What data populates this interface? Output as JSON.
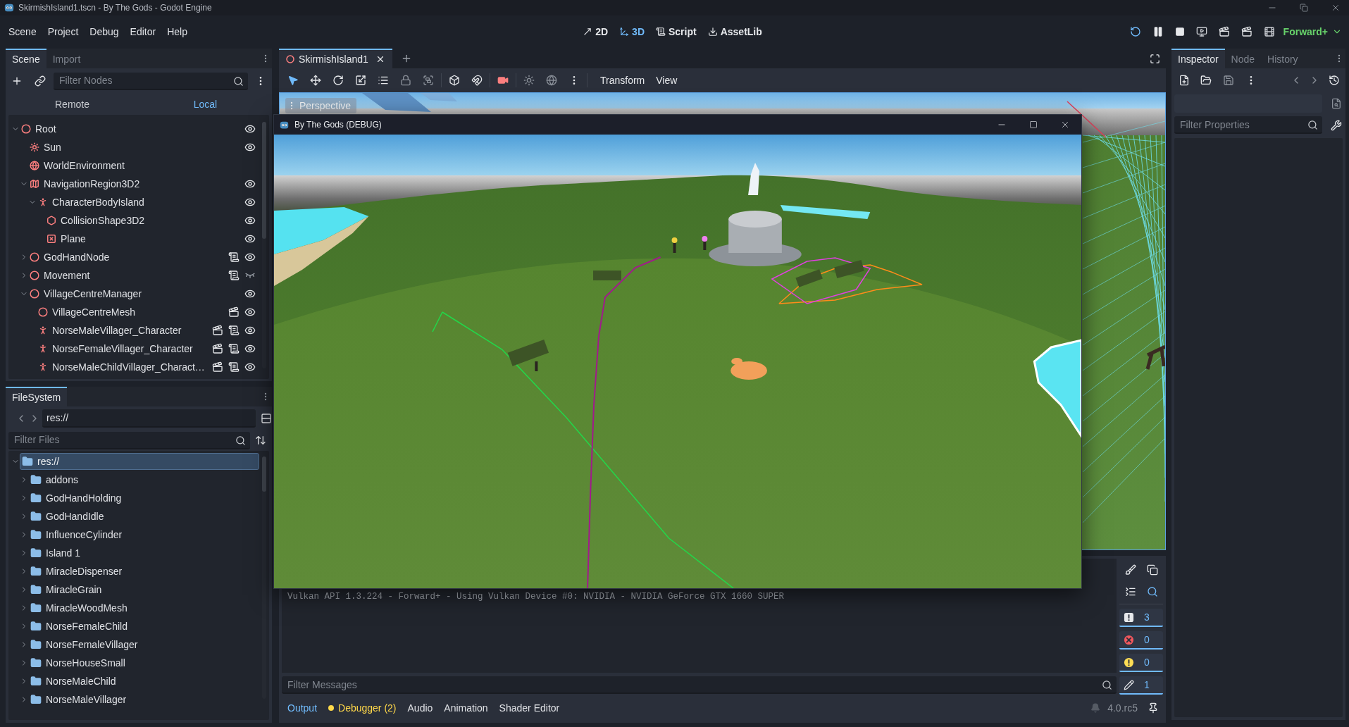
{
  "window": {
    "title": "SkirmishIsland1.tscn - By The Gods - Godot Engine"
  },
  "menu": [
    "Scene",
    "Project",
    "Debug",
    "Editor",
    "Help"
  ],
  "workspaces": [
    {
      "kind": "flat",
      "label": "2D",
      "selected": false
    },
    {
      "kind": "spatial",
      "label": "3D",
      "selected": true
    },
    {
      "kind": "script",
      "label": "Script",
      "selected": false
    },
    {
      "kind": "assetlib",
      "label": "AssetLib",
      "selected": false
    }
  ],
  "renderer": "Forward+",
  "scene_dock": {
    "tabs": [
      {
        "label": "Scene",
        "selected": true
      },
      {
        "label": "Import",
        "selected": false
      }
    ],
    "filter_placeholder": "Filter Nodes",
    "modes": [
      {
        "label": "Remote",
        "selected": false
      },
      {
        "label": "Local",
        "selected": true
      }
    ],
    "tree": [
      {
        "name": "Root",
        "kind": "node",
        "expanded": true,
        "visible": true,
        "children": [
          {
            "name": "Sun",
            "kind": "light",
            "visible": true
          },
          {
            "name": "WorldEnvironment",
            "kind": "environment"
          },
          {
            "name": "NavigationRegion3D2",
            "kind": "navigation",
            "expanded": true,
            "visible": true,
            "children": [
              {
                "name": "CharacterBodyIsland",
                "kind": "body",
                "expanded": true,
                "visible": true,
                "children": [
                  {
                    "name": "CollisionShape3D2",
                    "kind": "collision",
                    "visible": true
                  },
                  {
                    "name": "Plane",
                    "kind": "mesh",
                    "visible": true
                  }
                ]
              }
            ]
          },
          {
            "name": "GodHandNode",
            "kind": "node",
            "expanded": false,
            "script": true,
            "visible": true
          },
          {
            "name": "Movement",
            "kind": "node",
            "expanded": false,
            "script": true,
            "visible": false
          },
          {
            "name": "VillageCentreManager",
            "kind": "node",
            "expanded": true,
            "visible": true,
            "children": [
              {
                "name": "VillageCentreMesh",
                "kind": "node",
                "scene": true,
                "visible": true
              },
              {
                "name": "NorseMaleVillager_Character",
                "kind": "body",
                "scene": true,
                "script": true,
                "visible": true
              },
              {
                "name": "NorseFemaleVillager_Character",
                "kind": "body",
                "scene": true,
                "script": true,
                "visible": true
              },
              {
                "name": "NorseMaleChildVillager_Charact…",
                "kind": "body",
                "scene": true,
                "script": true,
                "visible": true
              }
            ]
          }
        ]
      }
    ]
  },
  "filesystem_dock": {
    "tabs": [
      {
        "label": "FileSystem",
        "selected": true
      }
    ],
    "path": "res://",
    "filter_placeholder": "Filter Files",
    "tree": [
      {
        "name": "res://",
        "selected": true,
        "expanded": true,
        "children": [
          {
            "name": "addons",
            "selected": false,
            "expanded": false
          },
          {
            "name": "GodHandHolding",
            "selected": false,
            "expanded": false
          },
          {
            "name": "GodHandIdle",
            "selected": false,
            "expanded": false
          },
          {
            "name": "InfluenceCylinder",
            "selected": false,
            "expanded": false
          },
          {
            "name": "Island 1",
            "selected": false,
            "expanded": false
          },
          {
            "name": "MiracleDispenser",
            "selected": false,
            "expanded": false
          },
          {
            "name": "MiracleGrain",
            "selected": false,
            "expanded": false
          },
          {
            "name": "MiracleWoodMesh",
            "selected": false,
            "expanded": false
          },
          {
            "name": "NorseFemaleChild",
            "selected": false,
            "expanded": false
          },
          {
            "name": "NorseFemaleVillager",
            "selected": false,
            "expanded": false
          },
          {
            "name": "NorseHouseSmall",
            "selected": false,
            "expanded": false
          },
          {
            "name": "NorseMaleChild",
            "selected": false,
            "expanded": false
          },
          {
            "name": "NorseMaleVillager",
            "selected": false,
            "expanded": false
          }
        ]
      }
    ]
  },
  "scene_tabs": [
    {
      "label": "SkirmishIsland1",
      "selected": true
    }
  ],
  "viewport_tools": [
    {
      "kind": "select",
      "selected": true
    },
    {
      "kind": "move",
      "selected": false
    },
    {
      "kind": "rotate",
      "selected": false
    },
    {
      "kind": "scale",
      "selected": false
    },
    {
      "kind": "list",
      "selected": false
    }
  ],
  "viewport_menus": [
    "Transform",
    "View"
  ],
  "viewport_label": "Perspective",
  "game_window": {
    "title": "By The Gods (DEBUG)"
  },
  "bottom_panel": {
    "log": [
      "Vulkan API 1.3.224 - Forward+ - Using Vulkan Device #0: NVIDIA - NVIDIA GeForce GTX 1660 SUPER"
    ],
    "filters": [
      {
        "kind": "message",
        "count": "3",
        "on": true
      },
      {
        "kind": "error",
        "count": "0",
        "on": true
      },
      {
        "kind": "warning",
        "count": "0",
        "on": true
      },
      {
        "kind": "editor",
        "count": "1",
        "on": true
      }
    ],
    "filter_placeholder": "Filter Messages",
    "tabs": [
      {
        "label": "Output",
        "selected": true,
        "alert": false
      },
      {
        "label": "Debugger (2)",
        "selected": false,
        "alert": true
      },
      {
        "label": "Audio",
        "selected": false,
        "alert": false
      },
      {
        "label": "Animation",
        "selected": false,
        "alert": false
      },
      {
        "label": "Shader Editor",
        "selected": false,
        "alert": false
      }
    ],
    "version": "4.0.rc5"
  },
  "inspector_dock": {
    "tabs": [
      {
        "label": "Inspector",
        "selected": true
      },
      {
        "label": "Node",
        "selected": false
      },
      {
        "label": "History",
        "selected": false
      }
    ],
    "filter_placeholder": "Filter Properties"
  }
}
